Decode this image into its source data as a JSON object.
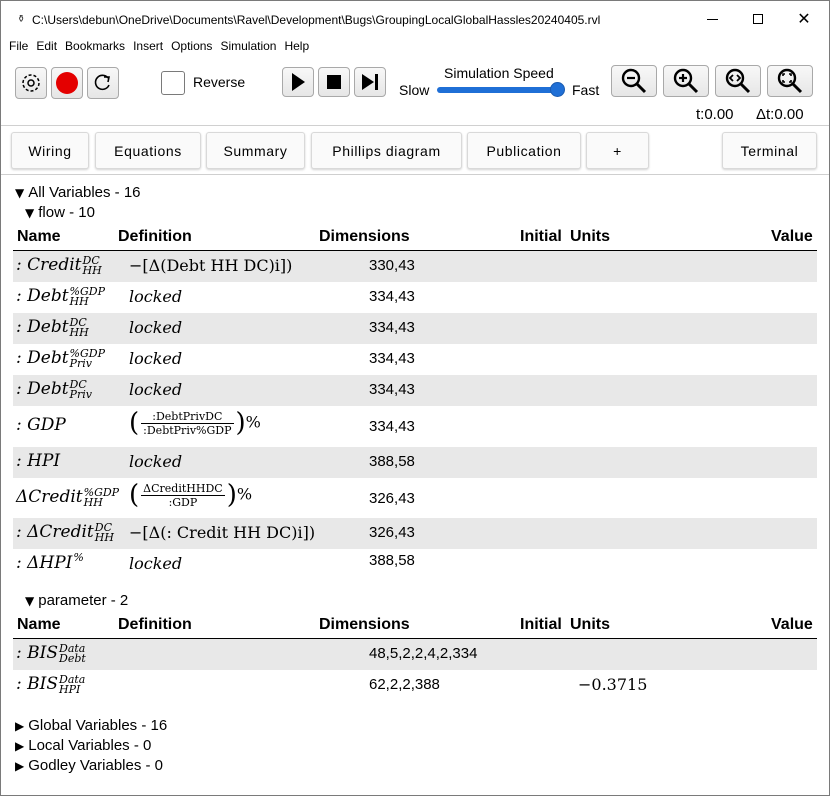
{
  "window": {
    "title": "C:\\Users\\debun\\OneDrive\\Documents\\Ravel\\Development\\Bugs\\GroupingLocalGlobalHassles20240405.rvl"
  },
  "menu": [
    "File",
    "Edit",
    "Bookmarks",
    "Insert",
    "Options",
    "Simulation",
    "Help"
  ],
  "toolbar": {
    "reverse_label": "Reverse",
    "speed_title": "Simulation Speed",
    "slow_label": "Slow",
    "fast_label": "Fast",
    "speed_fraction": 0.95,
    "t_label": "t:0.00",
    "dt_label": "Δt:0.00"
  },
  "tabs": [
    "Wiring",
    "Equations",
    "Summary",
    "Phillips diagram",
    "Publication",
    "+",
    "Terminal"
  ],
  "tree": {
    "all_variables": "All Variables - 16",
    "flow": "flow - 10",
    "parameter": "parameter - 2",
    "global": "Global Variables - 16",
    "local": "Local Variables - 0",
    "godley": "Godley Variables - 0"
  },
  "columns": {
    "name": "Name",
    "definition": "Definition",
    "dimensions": "Dimensions",
    "initial": "Initial",
    "units": "Units",
    "value": "Value"
  },
  "flow_rows": [
    {
      "prefix": ":",
      "base": "Credit",
      "sup": "DC",
      "sub": "HH",
      "definition": "−[Δ(Debt HH DC)i])",
      "dims": "330,43"
    },
    {
      "prefix": ":",
      "base": "Debt",
      "sup": "%GDP",
      "sub": "HH",
      "definition": "locked",
      "dims": "334,43"
    },
    {
      "prefix": ":",
      "base": "Debt",
      "sup": "DC",
      "sub": "HH",
      "definition": "locked",
      "dims": "334,43"
    },
    {
      "prefix": ":",
      "base": "Debt",
      "sup": "%GDP",
      "sub": "Priv",
      "definition": "locked",
      "dims": "334,43"
    },
    {
      "prefix": ":",
      "base": "Debt",
      "sup": "DC",
      "sub": "Priv",
      "definition": "locked",
      "dims": "334,43"
    },
    {
      "prefix": ":",
      "base": "GDP",
      "sup": "",
      "sub": "",
      "definition": ":Debt Priv DC / :Debt Priv %GDP %",
      "frac_num": ":DebtPrivDC",
      "frac_den": ":DebtPriv%GDP",
      "dims": "334,43"
    },
    {
      "prefix": ":",
      "base": "HPI",
      "sup": "",
      "sub": "",
      "definition": "locked",
      "dims": "388,58"
    },
    {
      "prefix": "",
      "base": "ΔCredit",
      "sup": "%GDP",
      "sub": "HH",
      "definition": "ΔCredit HH DC / :GDP %",
      "frac_num": "ΔCreditHHDC",
      "frac_den": ":GDP",
      "dims": "326,43"
    },
    {
      "prefix": ":",
      "base": "ΔCredit",
      "sup": "DC",
      "sub": "HH",
      "definition": "−[Δ(: Credit HH DC)i])",
      "dims": "326,43"
    },
    {
      "prefix": ":",
      "base": "ΔHPI",
      "sup": "%",
      "sub": "",
      "definition": "locked",
      "dims": "388,58"
    }
  ],
  "param_rows": [
    {
      "prefix": ":",
      "base": "BIS",
      "sup": "Data",
      "sub": "Debt",
      "dims": "48,5,2,2,4,2,334",
      "value": ""
    },
    {
      "prefix": ":",
      "base": "BIS",
      "sup": "Data",
      "sub": "HPI",
      "dims": "62,2,2,388",
      "value": "−0.3715"
    }
  ]
}
